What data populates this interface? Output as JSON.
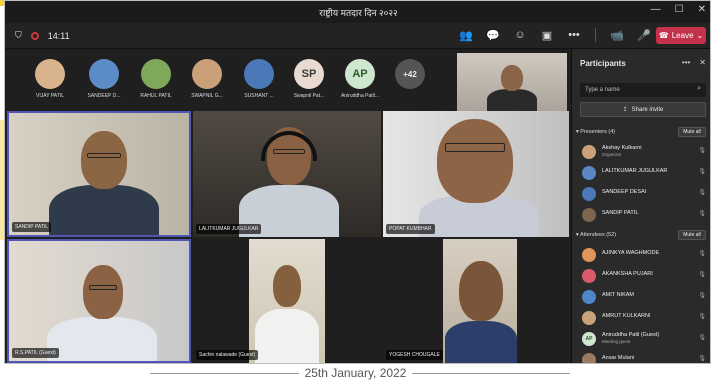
{
  "window": {
    "title": "राष्ट्रीय मतदार दिन २०२२",
    "controls": [
      "—",
      "☐",
      "✕"
    ]
  },
  "toolbar": {
    "time": "14:11",
    "icons": [
      "people-icon",
      "chat-icon",
      "reactions-icon",
      "rooms-icon",
      "more-icon",
      "camera-icon",
      "mic-icon",
      "share-icon"
    ],
    "glyphs": [
      "👥",
      "💬",
      "☺",
      "▣",
      "•••",
      "📹",
      "🎤",
      "⬆"
    ],
    "leave_label": "Leave"
  },
  "avatars": [
    {
      "name": "VIJAY PATIL",
      "initials": "",
      "color": "#d9b38c"
    },
    {
      "name": "SANDEEP D...",
      "initials": "",
      "color": "#5b8cc8"
    },
    {
      "name": "RAHUL PATIL",
      "initials": "",
      "color": "#7fa85a"
    },
    {
      "name": "SWAPNIL G...",
      "initials": "",
      "color": "#c9a07a"
    },
    {
      "name": "SUSHANT ...",
      "initials": "",
      "color": "#4a78b8"
    },
    {
      "name": "Swapnil Pat...",
      "initials": "SP",
      "color": "#e8d9d1"
    },
    {
      "name": "Aniruddha Patil...",
      "initials": "AP",
      "color": "#cfe6cf"
    },
    {
      "name": "",
      "initials": "+42",
      "color": "#555555"
    }
  ],
  "tiles": [
    {
      "label": "SANDIP PATIL"
    },
    {
      "label": "LALITKUMAR JUGULKAR"
    },
    {
      "label": "POPAT KUMBHAR"
    },
    {
      "label": "R.S.PATIL (Guest)"
    },
    {
      "label": "Sachin nalawade (Guest)"
    },
    {
      "label": "YOGESH CHOUGALE"
    }
  ],
  "panel": {
    "title": "Participants",
    "search_placeholder": "Type a name",
    "share_label": "Share invite",
    "presenters_header": "Presenters (4)",
    "attendees_header": "Attendees (52)",
    "mute_all": "Mute all",
    "presenters": [
      {
        "name": "Akshay Kulkarni",
        "sub": "Organizer",
        "initials": ""
      },
      {
        "name": "LALITKUMAR JUGULKAR",
        "sub": "",
        "initials": ""
      },
      {
        "name": "SANDEEP DESAI",
        "sub": "",
        "initials": ""
      },
      {
        "name": "SANDIP PATIL",
        "sub": "",
        "initials": ""
      }
    ],
    "attendees": [
      {
        "name": "AJINKYA WAGHMODE",
        "sub": "",
        "initials": ""
      },
      {
        "name": "AKANKSHA PUJARI",
        "sub": "",
        "initials": ""
      },
      {
        "name": "AMIT NIKAM",
        "sub": "",
        "initials": ""
      },
      {
        "name": "AMRUT KULKARNI",
        "sub": "",
        "initials": ""
      },
      {
        "name": "Aniruddha Patil (Guest)",
        "sub": "Meeting guest",
        "initials": "AP"
      },
      {
        "name": "Ansar Mulani",
        "sub": "",
        "initials": ""
      }
    ]
  },
  "footer": {
    "date": "25th January, 2022"
  }
}
